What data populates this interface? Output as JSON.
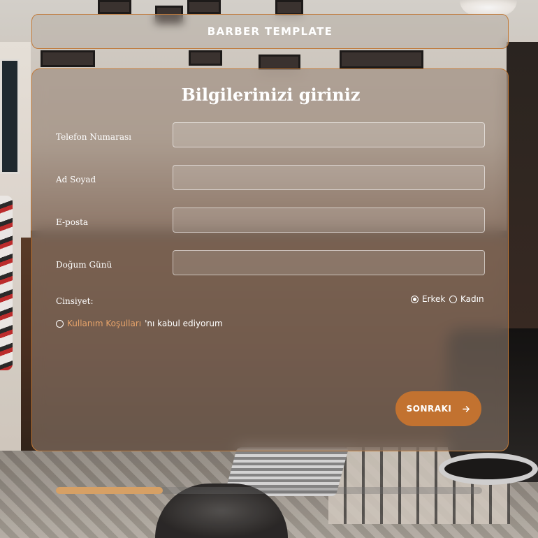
{
  "header": {
    "title": "BARBER TEMPLATE"
  },
  "form": {
    "title": "Bilgilerinizi giriniz",
    "fields": [
      {
        "label": "Telefon Numarası",
        "value": "",
        "placeholder": ""
      },
      {
        "label": "Ad Soyad",
        "value": "",
        "placeholder": ""
      },
      {
        "label": "E-posta",
        "value": "",
        "placeholder": ""
      },
      {
        "label": "Doğum Günü",
        "value": "",
        "placeholder": ""
      }
    ],
    "gender": {
      "label": "Cinsiyet:",
      "options": [
        {
          "label": "Erkek",
          "checked": true
        },
        {
          "label": "Kadın",
          "checked": false
        }
      ]
    },
    "terms": {
      "link_text": "Kullanım Koşulları",
      "suffix_text": "'nı kabul ediyorum",
      "checked": false
    },
    "next_button": {
      "label": "SONRAKI",
      "icon": "arrow-right-icon"
    }
  },
  "progress": {
    "fraction": 0.25
  },
  "colors": {
    "accent": "#c27230",
    "border_accent": "#c07a3a",
    "progress_fill": "#d6a065",
    "link": "#e7a36a"
  }
}
